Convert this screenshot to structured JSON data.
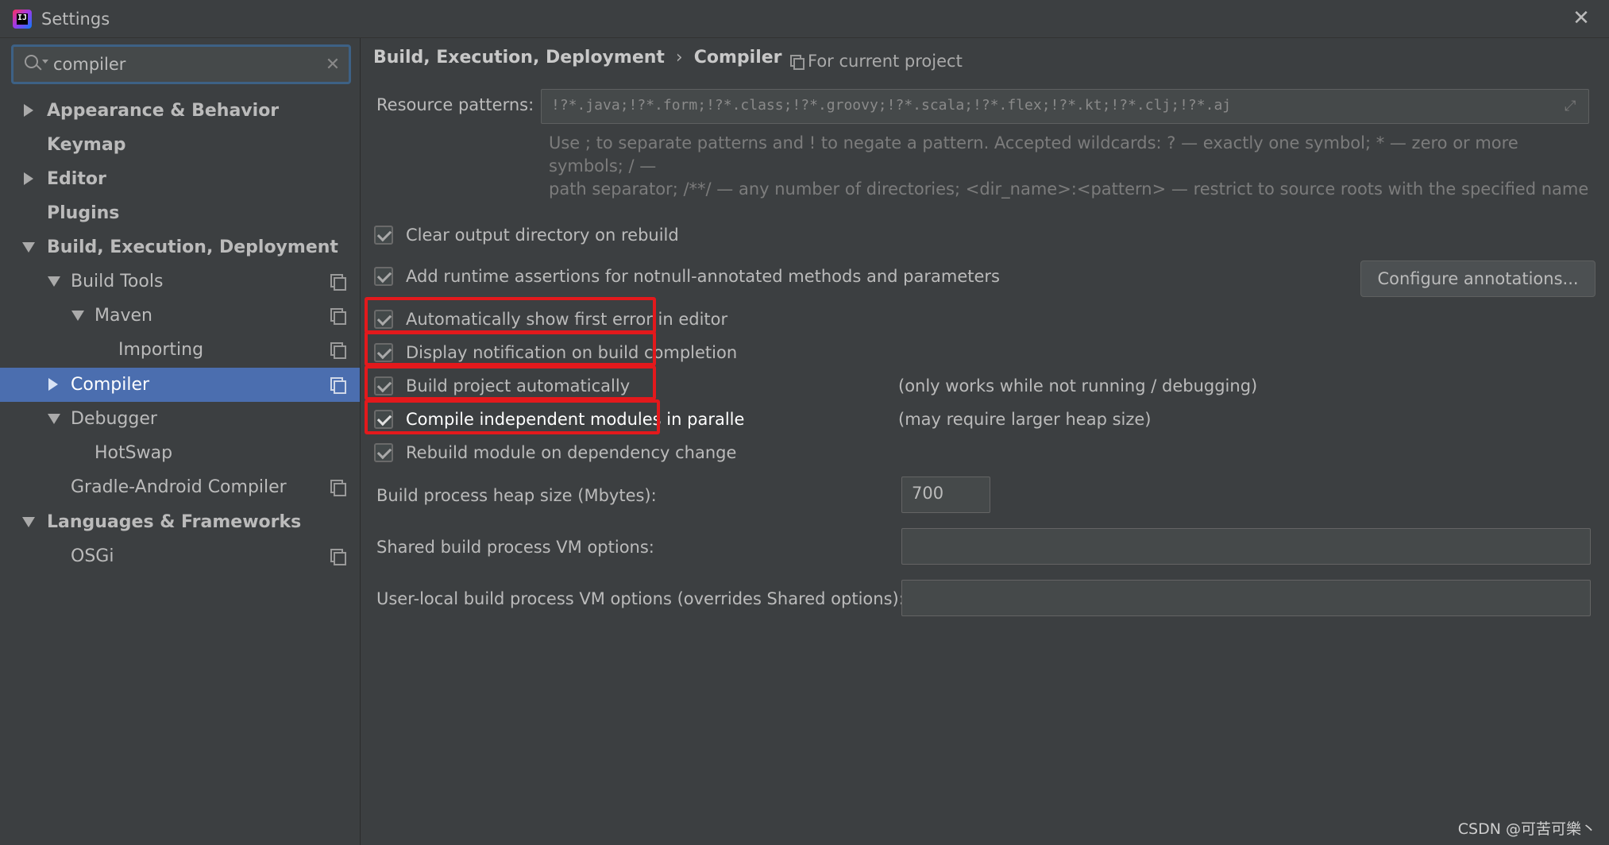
{
  "window": {
    "title": "Settings",
    "app_icon_text": "IJ"
  },
  "search": {
    "value": "compiler"
  },
  "sidebar": {
    "items": [
      {
        "label": "Appearance & Behavior"
      },
      {
        "label": "Keymap"
      },
      {
        "label": "Editor"
      },
      {
        "label": "Plugins"
      },
      {
        "label": "Build, Execution, Deployment"
      },
      {
        "label": "Build Tools"
      },
      {
        "label": "Maven"
      },
      {
        "label": "Importing"
      },
      {
        "label": "Compiler"
      },
      {
        "label": "Debugger"
      },
      {
        "label": "HotSwap"
      },
      {
        "label": "Gradle-Android Compiler"
      },
      {
        "label": "Languages & Frameworks"
      },
      {
        "label": "OSGi"
      }
    ]
  },
  "header": {
    "breadcrumb_parent": "Build, Execution, Deployment",
    "breadcrumb_separator": "›",
    "breadcrumb_current": "Compiler",
    "scope": "For current project"
  },
  "compiler": {
    "resource_patterns_label": "Resource patterns:",
    "resource_patterns_value": "!?*.java;!?*.form;!?*.class;!?*.groovy;!?*.scala;!?*.flex;!?*.kt;!?*.clj;!?*.aj",
    "hint_line1": "Use ; to separate patterns and ! to negate a pattern. Accepted wildcards: ? — exactly one symbol; * — zero or more symbols; / —",
    "hint_line2": "path separator; /**/ — any number of directories; <dir_name>:<pattern> — restrict to source roots with the specified name",
    "options": [
      {
        "label": "Clear output directory on rebuild",
        "checked": true
      },
      {
        "label": "Add runtime assertions for notnull-annotated methods and parameters",
        "checked": true
      },
      {
        "label": "Automatically show first error in editor",
        "checked": true
      },
      {
        "label": "Display notification on build completion",
        "checked": true
      },
      {
        "label": "Build project automatically",
        "checked": true
      },
      {
        "label": "Compile independent modules in paralle",
        "checked": true
      },
      {
        "label": "Rebuild module on dependency change",
        "checked": true
      }
    ],
    "configure_button": "Configure annotations...",
    "note_build_auto": "(only works while not running / debugging)",
    "note_parallel": "(may require larger heap size)",
    "heap_label": "Build process heap size (Mbytes):",
    "heap_value": "700",
    "shared_vm_label": "Shared build process VM options:",
    "shared_vm_value": "",
    "user_vm_label": "User-local build process VM options (overrides Shared options):",
    "user_vm_value": ""
  },
  "watermark": "CSDN @可苦可樂丶",
  "colors": {
    "highlight": "#e3191c",
    "selection": "#4b6eaf",
    "background": "#3c3f41"
  }
}
